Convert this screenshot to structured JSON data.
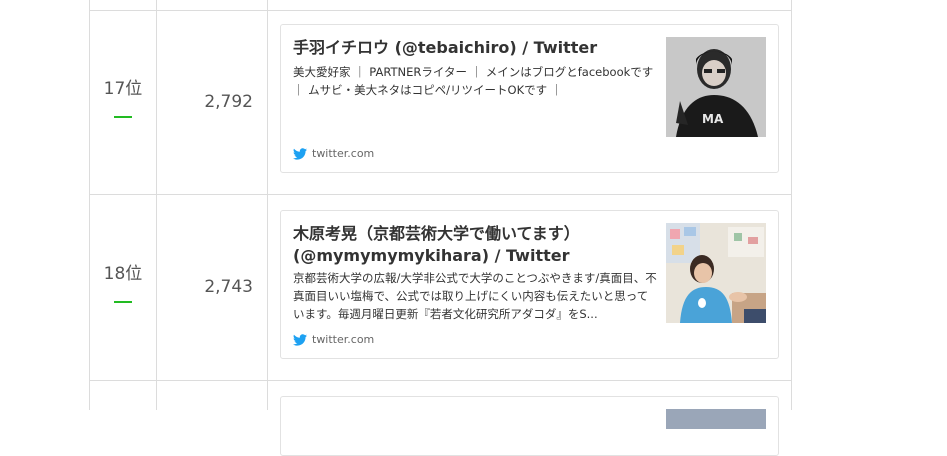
{
  "rows": [
    {
      "rank": "17位",
      "count": "2,792",
      "card": {
        "title": "手羽イチロウ (@tebaichiro) / Twitter",
        "description": "美大愛好家 ｜ PARTNERライター ｜ メインはブログとfacebookです ｜ ムサビ・美大ネタはコピペ/リツイートOKです ｜",
        "domain": "twitter.com"
      }
    },
    {
      "rank": "18位",
      "count": "2,743",
      "card": {
        "title": "木原考晃（京都芸術大学で働いてます） (@mymymymykihara) / Twitter",
        "description": "京都芸術大学の広報/大学非公式で大学のことつぶやきます/真面目、不真面目いい塩梅で、公式では取り上げにくい内容も伝えたいと思っています。毎週月曜日更新『若者文化研究所アダコダ』をS...",
        "domain": "twitter.com"
      }
    }
  ],
  "colors": {
    "rank_change_neutral": "#22bb22",
    "twitter_blue": "#1da1f2",
    "border": "#dcdcdc"
  },
  "icons": {
    "domain_icon": "twitter-bird-icon",
    "rank_change": "no-change-dash"
  }
}
